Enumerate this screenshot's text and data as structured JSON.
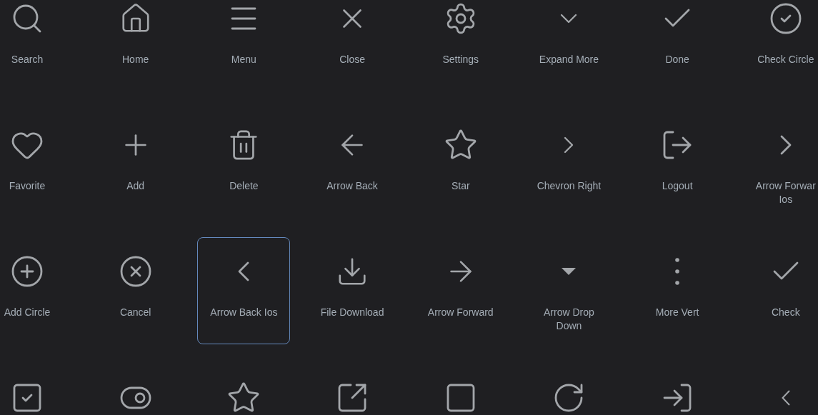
{
  "icons": [
    {
      "kind": "search",
      "label": "Search",
      "selected": false
    },
    {
      "kind": "home",
      "label": "Home",
      "selected": false
    },
    {
      "kind": "menu",
      "label": "Menu",
      "selected": false
    },
    {
      "kind": "close",
      "label": "Close",
      "selected": false
    },
    {
      "kind": "settings",
      "label": "Settings",
      "selected": false
    },
    {
      "kind": "expand",
      "label": "Expand More",
      "selected": false
    },
    {
      "kind": "done",
      "label": "Done",
      "selected": false
    },
    {
      "kind": "checkcircle",
      "label": "Check Circle",
      "selected": false
    },
    {
      "kind": "favorite",
      "label": "Favorite",
      "selected": false
    },
    {
      "kind": "add",
      "label": "Add",
      "selected": false
    },
    {
      "kind": "delete",
      "label": "Delete",
      "selected": false
    },
    {
      "kind": "back",
      "label": "Arrow Back",
      "selected": false
    },
    {
      "kind": "star",
      "label": "Star",
      "selected": false
    },
    {
      "kind": "chevronright",
      "label": "Chevron Right",
      "selected": false
    },
    {
      "kind": "logout",
      "label": "Logout",
      "selected": false
    },
    {
      "kind": "forwardios",
      "label": "Arrow Forwar Ios",
      "selected": false
    },
    {
      "kind": "addcircle",
      "label": "Add Circle",
      "selected": false
    },
    {
      "kind": "cancel",
      "label": "Cancel",
      "selected": false
    },
    {
      "kind": "backios",
      "label": "Arrow Back Ios",
      "selected": true
    },
    {
      "kind": "download",
      "label": "File Download",
      "selected": false
    },
    {
      "kind": "forward",
      "label": "Arrow Forward",
      "selected": false
    },
    {
      "kind": "dropdown",
      "label": "Arrow Drop Down",
      "selected": false
    },
    {
      "kind": "morevert",
      "label": "More Vert",
      "selected": false
    },
    {
      "kind": "check",
      "label": "Check",
      "selected": false
    },
    {
      "kind": "checkbox",
      "selected": false
    },
    {
      "kind": "toggle",
      "selected": false
    },
    {
      "kind": "starborder",
      "selected": false
    },
    {
      "kind": "openinnew",
      "selected": false
    },
    {
      "kind": "square",
      "selected": false
    },
    {
      "kind": "refresh",
      "selected": false
    },
    {
      "kind": "login",
      "selected": false
    },
    {
      "kind": "chevronleft",
      "selected": false
    }
  ]
}
